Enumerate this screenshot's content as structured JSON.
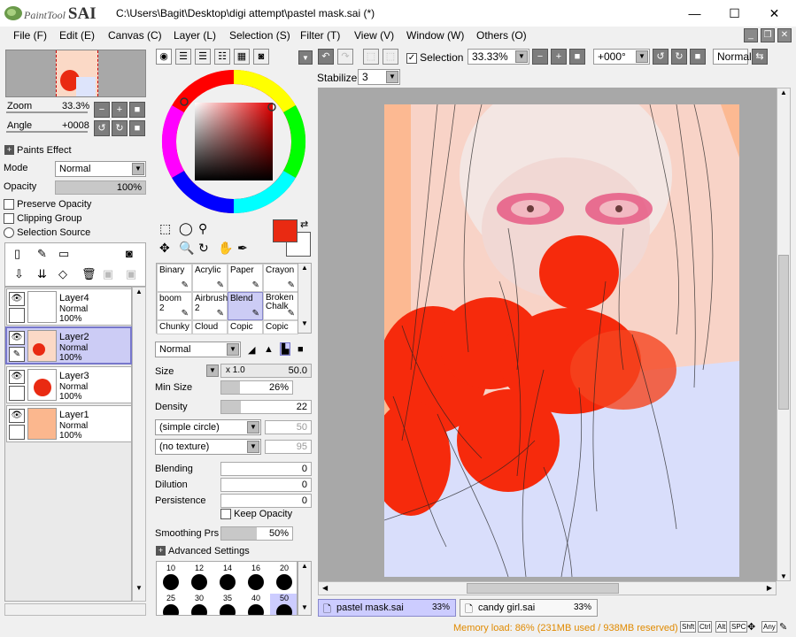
{
  "app": {
    "logo_text": "PaintTool",
    "logo_text2": "SAI",
    "title": "C:\\Users\\Bagit\\Desktop\\digi attempt\\pastel mask.sai (*)"
  },
  "window_controls": {
    "minimize": "—",
    "maximize": "☐",
    "close": "✕"
  },
  "menu": [
    "File (F)",
    "Edit (E)",
    "Canvas (C)",
    "Layer (L)",
    "Selection (S)",
    "Filter (T)",
    "View (V)",
    "Window (W)",
    "Others (O)"
  ],
  "navigator": {
    "zoom_label": "Zoom",
    "zoom_value": "33.3%",
    "angle_label": "Angle",
    "angle_value": "+0008"
  },
  "layer_props": {
    "paints_effect": "Paints Effect",
    "mode_label": "Mode",
    "mode_value": "Normal",
    "opacity_label": "Opacity",
    "opacity_value": "100%",
    "opacity_fraction": 1.0,
    "preserve_opacity": "Preserve Opacity",
    "clipping_group": "Clipping Group",
    "selection_source": "Selection Source"
  },
  "layers": [
    {
      "name": "Layer4",
      "mode": "Normal",
      "opacity": "100%",
      "selected": false
    },
    {
      "name": "Layer2",
      "mode": "Normal",
      "opacity": "100%",
      "selected": true
    },
    {
      "name": "Layer3",
      "mode": "Normal",
      "opacity": "100%",
      "selected": false
    },
    {
      "name": "Layer1",
      "mode": "Normal",
      "opacity": "100%",
      "selected": false
    }
  ],
  "tools": {
    "rows": [
      [
        {
          "name": "Binary",
          "size": ""
        },
        {
          "name": "Acrylic",
          "size": ""
        },
        {
          "name": "Paper",
          "size": ""
        },
        {
          "name": "Crayon",
          "size": ""
        }
      ],
      [
        {
          "name": "boom",
          "size": "2"
        },
        {
          "name": "Airbrush",
          "size": "2"
        },
        {
          "name": "Blend",
          "size": ""
        },
        {
          "name": "Broken Chalk",
          "size": ""
        }
      ],
      [
        {
          "name": "Chunky",
          "size": ""
        },
        {
          "name": "Cloud",
          "size": ""
        },
        {
          "name": "Copic",
          "size": ""
        },
        {
          "name": "Copic",
          "size": ""
        }
      ]
    ],
    "selected": "Blend"
  },
  "brush": {
    "blend_mode": "Normal",
    "size_label": "Size",
    "size_mult": "x 1.0",
    "size_value": "50.0",
    "minsize_label": "Min Size",
    "minsize_value": "26%",
    "minsize_fraction": 0.26,
    "density_label": "Density",
    "density_value": "22",
    "density_fraction": 0.22,
    "shape": "(simple circle)",
    "shape_value": "50",
    "texture": "(no texture)",
    "texture_value": "95",
    "blending_label": "Blending",
    "blending_value": "0",
    "dilution_label": "Dilution",
    "dilution_value": "0",
    "persistence_label": "Persistence",
    "persistence_value": "0",
    "keep_opacity": "Keep Opacity",
    "smoothing_label": "Smoothing Prs",
    "smoothing_value": "50%",
    "smoothing_fraction": 0.5,
    "advanced": "Advanced Settings"
  },
  "brush_sizes": {
    "row1": [
      "10",
      "12",
      "14",
      "16",
      "20"
    ],
    "row2": [
      "25",
      "30",
      "35",
      "40",
      "50"
    ],
    "selected": "50"
  },
  "colors": {
    "primary": "#e92a12",
    "secondary": "#ffffff"
  },
  "toolbar": {
    "selection_label": "Selection",
    "zoom_value": "33.33%",
    "angle_value": "+000°",
    "blend_value": "Normal",
    "stabilizer_label": "Stabilizer",
    "stabilizer_value": "3"
  },
  "documents": [
    {
      "name": "pastel mask.sai",
      "zoom": "33%",
      "active": true
    },
    {
      "name": "candy girl.sai",
      "zoom": "33%",
      "active": false
    }
  ],
  "status": {
    "memory": "Memory load: 86% (231MB used / 938MB reserved)",
    "keys": [
      "Shft",
      "Ctrl",
      "Alt",
      "SPC",
      "Any"
    ]
  }
}
